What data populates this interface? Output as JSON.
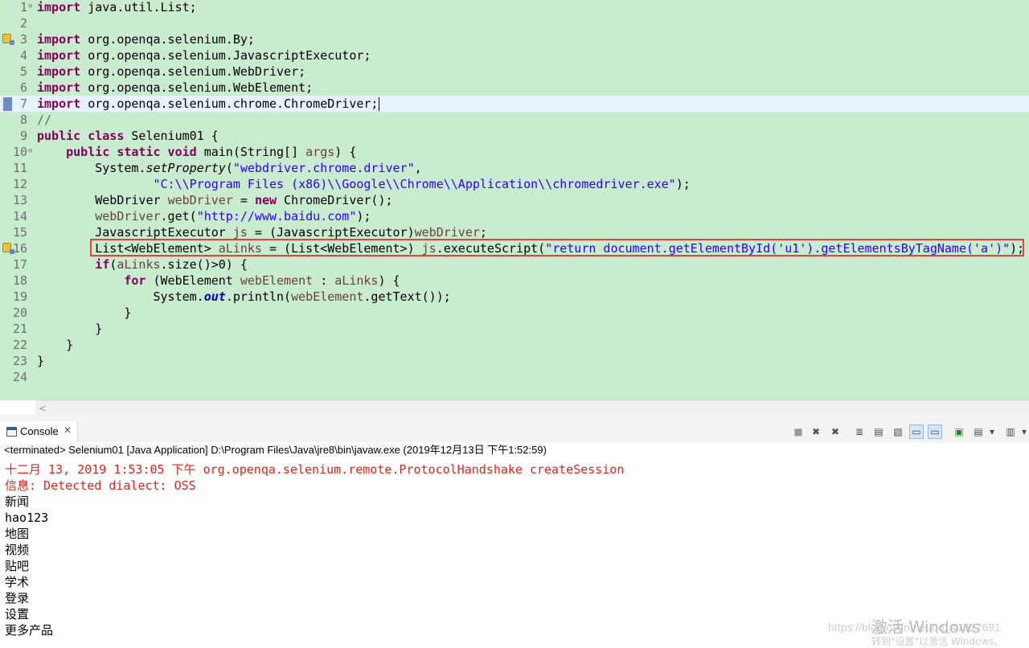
{
  "editor": {
    "lines": [
      {
        "n": "1",
        "tokens": [
          {
            "t": "import",
            "c": "kw"
          },
          {
            "t": " java.util.List;"
          }
        ]
      },
      {
        "n": "2",
        "tokens": []
      },
      {
        "n": "3",
        "tokens": [
          {
            "t": "import",
            "c": "kw"
          },
          {
            "t": " org.openqa.selenium.By;"
          }
        ]
      },
      {
        "n": "4",
        "tokens": [
          {
            "t": "import",
            "c": "kw"
          },
          {
            "t": " org.openqa.selenium.JavascriptExecutor;"
          }
        ]
      },
      {
        "n": "5",
        "tokens": [
          {
            "t": "import",
            "c": "kw"
          },
          {
            "t": " org.openqa.selenium.WebDriver;"
          }
        ]
      },
      {
        "n": "6",
        "tokens": [
          {
            "t": "import",
            "c": "kw"
          },
          {
            "t": " org.openqa.selenium.WebElement;"
          }
        ]
      },
      {
        "n": "7",
        "tokens": [
          {
            "t": "import",
            "c": "kw"
          },
          {
            "t": " org.openqa.selenium.chrome.ChromeDriver;"
          }
        ]
      },
      {
        "n": "8",
        "tokens": [
          {
            "t": "//",
            "c": "com"
          }
        ]
      },
      {
        "n": "9",
        "tokens": [
          {
            "t": "public class",
            "c": "kw"
          },
          {
            "t": " Selenium01 {"
          }
        ]
      },
      {
        "n": "10",
        "tokens": [
          {
            "t": "    "
          },
          {
            "t": "public static void",
            "c": "kw"
          },
          {
            "t": " main(String[] "
          },
          {
            "t": "args",
            "c": "var"
          },
          {
            "t": ") {"
          }
        ]
      },
      {
        "n": "11",
        "tokens": [
          {
            "t": "        System."
          },
          {
            "t": "setProperty",
            "c": "smeth"
          },
          {
            "t": "("
          },
          {
            "t": "\"webdriver.chrome.driver\"",
            "c": "str"
          },
          {
            "t": ","
          }
        ]
      },
      {
        "n": "12",
        "tokens": [
          {
            "t": "                "
          },
          {
            "t": "\"C:\\\\Program Files (x86)\\\\Google\\\\Chrome\\\\Application\\\\chromedriver.exe\"",
            "c": "str"
          },
          {
            "t": ");"
          }
        ]
      },
      {
        "n": "13",
        "tokens": [
          {
            "t": "        WebDriver "
          },
          {
            "t": "webDriver",
            "c": "var"
          },
          {
            "t": " = "
          },
          {
            "t": "new",
            "c": "kw"
          },
          {
            "t": " ChromeDriver();"
          }
        ]
      },
      {
        "n": "14",
        "tokens": [
          {
            "t": "        "
          },
          {
            "t": "webDriver",
            "c": "var"
          },
          {
            "t": ".get("
          },
          {
            "t": "\"http://www.baidu.com\"",
            "c": "str"
          },
          {
            "t": ");"
          }
        ]
      },
      {
        "n": "15",
        "tokens": [
          {
            "t": "        JavascriptExecutor "
          },
          {
            "t": "js",
            "c": "var"
          },
          {
            "t": " = (JavascriptExecutor)"
          },
          {
            "t": "webDriver",
            "c": "var"
          },
          {
            "t": ";"
          }
        ]
      },
      {
        "n": "16",
        "tokens": [
          {
            "t": "        List<WebElement> "
          },
          {
            "t": "aLinks",
            "c": "var"
          },
          {
            "t": " = (List<WebElement>) "
          },
          {
            "t": "js",
            "c": "var"
          },
          {
            "t": ".executeScript("
          },
          {
            "t": "\"return document.getElementById('u1').getElementsByTagName('a')\"",
            "c": "str"
          },
          {
            "t": ");"
          }
        ]
      },
      {
        "n": "17",
        "tokens": [
          {
            "t": "        "
          },
          {
            "t": "if",
            "c": "kw"
          },
          {
            "t": "("
          },
          {
            "t": "aLinks",
            "c": "var"
          },
          {
            "t": ".size()>0) {"
          }
        ]
      },
      {
        "n": "18",
        "tokens": [
          {
            "t": "            "
          },
          {
            "t": "for",
            "c": "kw"
          },
          {
            "t": " (WebElement "
          },
          {
            "t": "webElement",
            "c": "var"
          },
          {
            "t": " : "
          },
          {
            "t": "aLinks",
            "c": "var"
          },
          {
            "t": ") {"
          }
        ]
      },
      {
        "n": "19",
        "tokens": [
          {
            "t": "                System."
          },
          {
            "t": "out",
            "c": "sfield"
          },
          {
            "t": ".println("
          },
          {
            "t": "webElement",
            "c": "var"
          },
          {
            "t": ".getText());"
          }
        ]
      },
      {
        "n": "20",
        "tokens": [
          {
            "t": "            }"
          }
        ]
      },
      {
        "n": "21",
        "tokens": [
          {
            "t": "        }"
          }
        ]
      },
      {
        "n": "22",
        "tokens": [
          {
            "t": "    }"
          }
        ]
      },
      {
        "n": "23",
        "tokens": [
          {
            "t": "}"
          }
        ]
      },
      {
        "n": "24",
        "tokens": []
      }
    ]
  },
  "scrollbar": {
    "left_arrow": "<"
  },
  "console": {
    "tab_label": "Console",
    "tab_close": "✕",
    "status": "<terminated> Selenium01 [Java Application] D:\\Program Files\\Java\\jre8\\bin\\javaw.exe (2019年12月13日 下午1:52:59)",
    "output": [
      {
        "text": "十二月 13, 2019 1:53:05 下午 org.openqa.selenium.remote.ProtocolHandshake createSession",
        "style": "err"
      },
      {
        "text": "信息: Detected dialect: OSS",
        "style": "err"
      },
      {
        "text": "新闻",
        "style": "norm cjk"
      },
      {
        "text": "hao123",
        "style": "norm"
      },
      {
        "text": "地图",
        "style": "norm cjk"
      },
      {
        "text": "视频",
        "style": "norm cjk"
      },
      {
        "text": "贴吧",
        "style": "norm cjk"
      },
      {
        "text": "学术",
        "style": "norm cjk"
      },
      {
        "text": "登录",
        "style": "norm cjk"
      },
      {
        "text": "设置",
        "style": "norm cjk"
      },
      {
        "text": "更多产品",
        "style": "norm cjk"
      }
    ]
  },
  "toolbar": {
    "buttons": [
      {
        "name": "terminate-button",
        "glyph": "■"
      },
      {
        "name": "remove-launch-button",
        "glyph": "✖"
      },
      {
        "name": "remove-all-terminated-button",
        "glyph": "✖"
      },
      {
        "name": "scroll-lock-button",
        "glyph": "≣"
      },
      {
        "name": "word-wrap-button",
        "glyph": "▤"
      },
      {
        "name": "clear-console-button",
        "glyph": "▧"
      },
      {
        "name": "pin-console-button",
        "glyph": "▭"
      },
      {
        "name": "show-when-output-button",
        "glyph": "▭"
      },
      {
        "name": "display-selected-console-button",
        "glyph": "▣"
      },
      {
        "name": "open-console-button",
        "glyph": "▤"
      },
      {
        "name": "open-console-dropdown",
        "glyph": "▾"
      },
      {
        "name": "new-console-view-button",
        "glyph": "▥"
      },
      {
        "name": "new-console-dropdown",
        "glyph": "▾"
      }
    ]
  },
  "watermark": {
    "url": "https://blog.csdn.net/qq_41917691",
    "windows_title": "激活 Windows",
    "windows_sub": "转到\"设置\"以激活 Windows。"
  }
}
